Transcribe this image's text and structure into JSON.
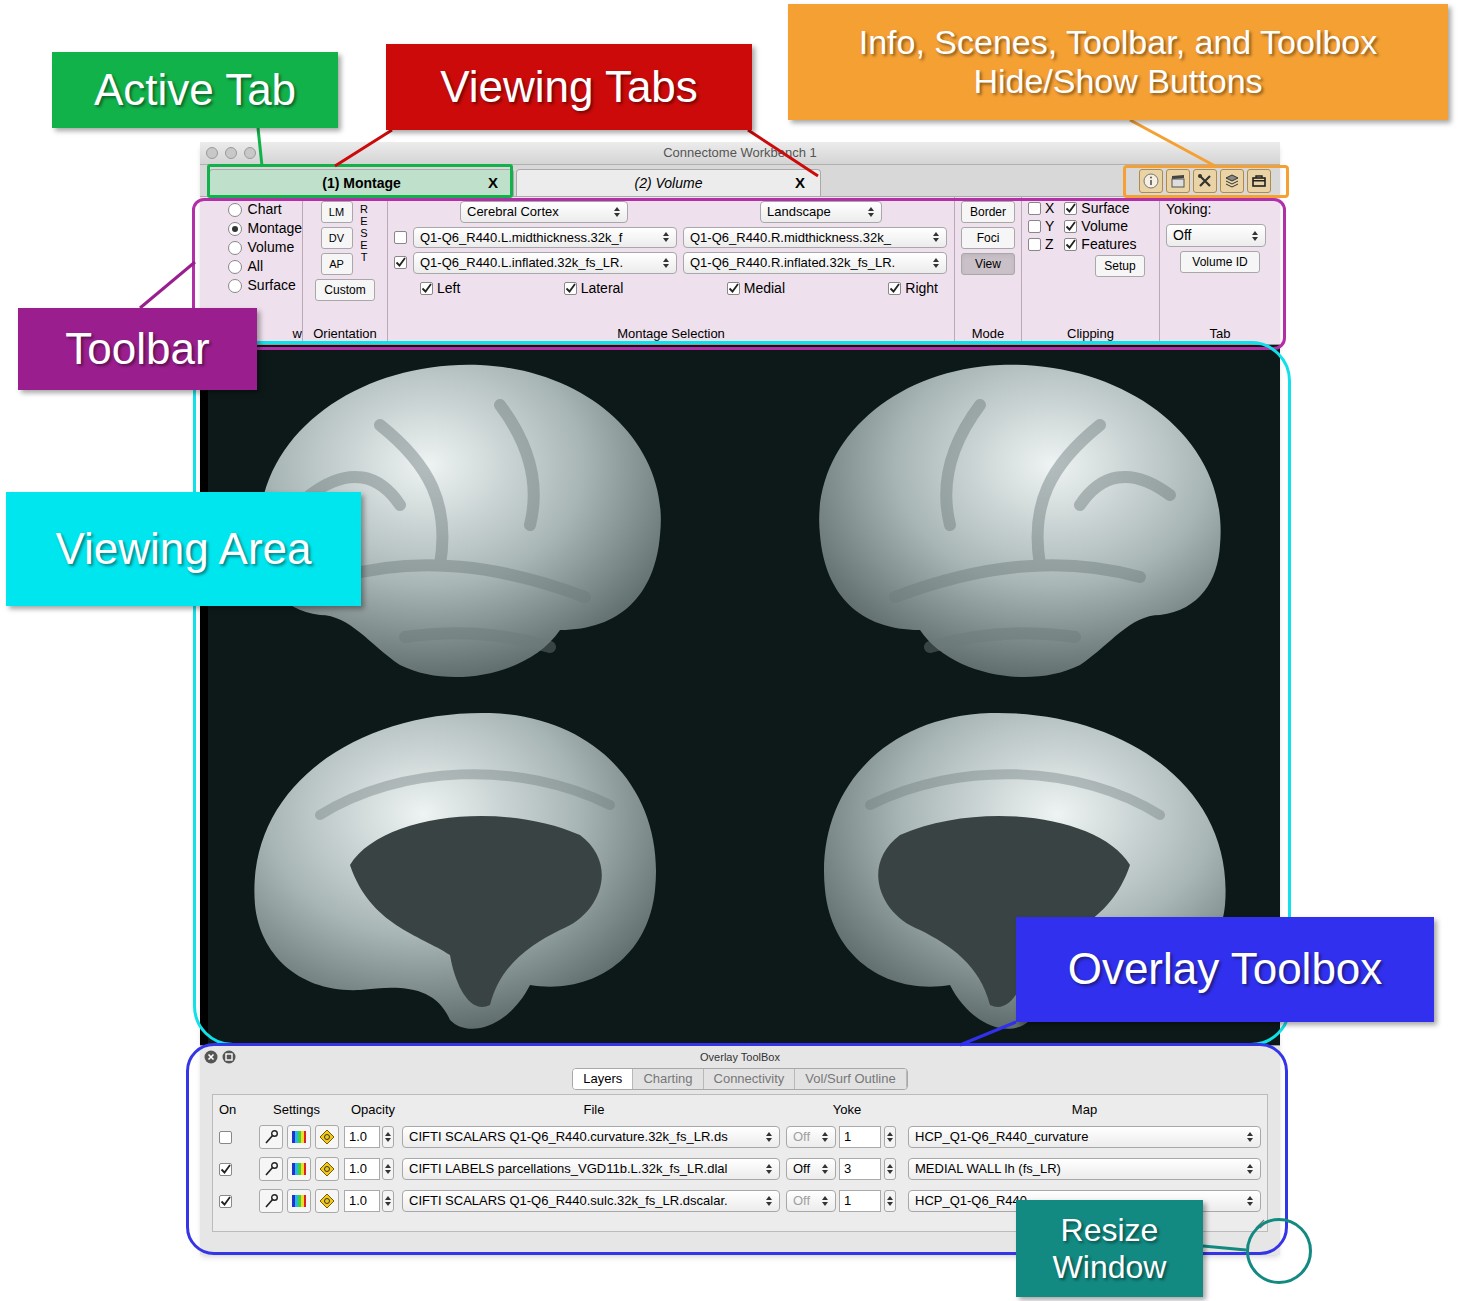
{
  "callouts": [
    {
      "lines": [
        "Active Tab"
      ],
      "color": "#12b24b"
    },
    {
      "lines": [
        "Viewing Tabs"
      ],
      "color": "#cc0a0a"
    },
    {
      "lines": [
        "Info, Scenes, Toolbar, and Toolbox",
        "Hide/Show Buttons"
      ],
      "color": "#f5a033"
    },
    {
      "lines": [
        "Toolbar"
      ],
      "color": "#9b1e8e"
    },
    {
      "lines": [
        "Viewing Area"
      ],
      "color": "#00e6ee"
    },
    {
      "lines": [
        "Overlay Toolbox"
      ],
      "color": "#3030ee"
    },
    {
      "lines": [
        "Resize",
        "Window"
      ],
      "color": "#128a82"
    }
  ],
  "window": {
    "title": "Connectome Workbench 1"
  },
  "tabs": [
    {
      "label": "(1) Montage",
      "close": "X",
      "selected": true
    },
    {
      "label": "(2) Volume",
      "close": "X",
      "selected": false
    }
  ],
  "toolbar": {
    "view": {
      "label": "w",
      "options": [
        {
          "label": "Chart",
          "selected": false
        },
        {
          "label": "Montage",
          "selected": true
        },
        {
          "label": "Volume",
          "selected": false
        },
        {
          "label": "All",
          "selected": false
        },
        {
          "label": "Surface",
          "selected": false
        }
      ]
    },
    "orientation": {
      "label": "Orientation",
      "buttons": [
        "LM",
        "DV",
        "AP"
      ],
      "reset": "RESET",
      "custom": "Custom"
    },
    "montage": {
      "label": "Montage Selection",
      "structure": "Cerebral Cortex",
      "layout": "Landscape",
      "rows": [
        {
          "checked": false,
          "left": "Q1-Q6_R440.L.midthickness.32k_f",
          "right": "Q1-Q6_R440.R.midthickness.32k_"
        },
        {
          "checked": true,
          "left": "Q1-Q6_R440.L.inflated.32k_fs_LR.",
          "right": "Q1-Q6_R440.R.inflated.32k_fs_LR."
        }
      ],
      "views": [
        {
          "label": "Left",
          "checked": true
        },
        {
          "label": "Lateral",
          "checked": true
        },
        {
          "label": "Medial",
          "checked": true
        },
        {
          "label": "Right",
          "checked": true
        }
      ]
    },
    "mode": {
      "label": "Mode",
      "buttons": [
        {
          "label": "Border",
          "selected": false
        },
        {
          "label": "Foci",
          "selected": false
        },
        {
          "label": "View",
          "selected": true
        }
      ]
    },
    "clipping": {
      "label": "Clipping",
      "axes": [
        {
          "label": "X",
          "checked": false
        },
        {
          "label": "Y",
          "checked": false
        },
        {
          "label": "Z",
          "checked": false
        }
      ],
      "layers": [
        {
          "label": "Surface",
          "checked": true
        },
        {
          "label": "Volume",
          "checked": true
        },
        {
          "label": "Features",
          "checked": true
        }
      ],
      "setup": "Setup"
    },
    "tab": {
      "label": "Tab",
      "yoking_label": "Yoking:",
      "yoking": "Off",
      "button": "Volume ID"
    }
  },
  "toolbox": {
    "title": "Overlay ToolBox",
    "tabs": [
      {
        "label": "Layers",
        "selected": true
      },
      {
        "label": "Charting",
        "selected": false
      },
      {
        "label": "Connectivity",
        "selected": false
      },
      {
        "label": "Vol/Surf Outline",
        "selected": false
      }
    ],
    "columns": [
      "On",
      "Settings",
      "Opacity",
      "File",
      "Yoke",
      "Map"
    ],
    "rows": [
      {
        "on": false,
        "opacity": "1.0",
        "file": "CIFTI SCALARS Q1-Q6_R440.curvature.32k_fs_LR.ds",
        "yoke": "Off",
        "yoke_enabled": false,
        "map_index": "1",
        "map": "HCP_Q1-Q6_R440_curvature"
      },
      {
        "on": true,
        "opacity": "1.0",
        "file": "CIFTI LABELS parcellations_VGD11b.L.32k_fs_LR.dlal",
        "yoke": "Off",
        "yoke_enabled": true,
        "map_index": "3",
        "map": "MEDIAL WALL lh (fs_LR)"
      },
      {
        "on": true,
        "opacity": "1.0",
        "file": "CIFTI SCALARS Q1-Q6_R440.sulc.32k_fs_LR.dscalar.",
        "yoke": "Off",
        "yoke_enabled": false,
        "map_index": "1",
        "map": "HCP_Q1-Q6_R440"
      }
    ]
  }
}
